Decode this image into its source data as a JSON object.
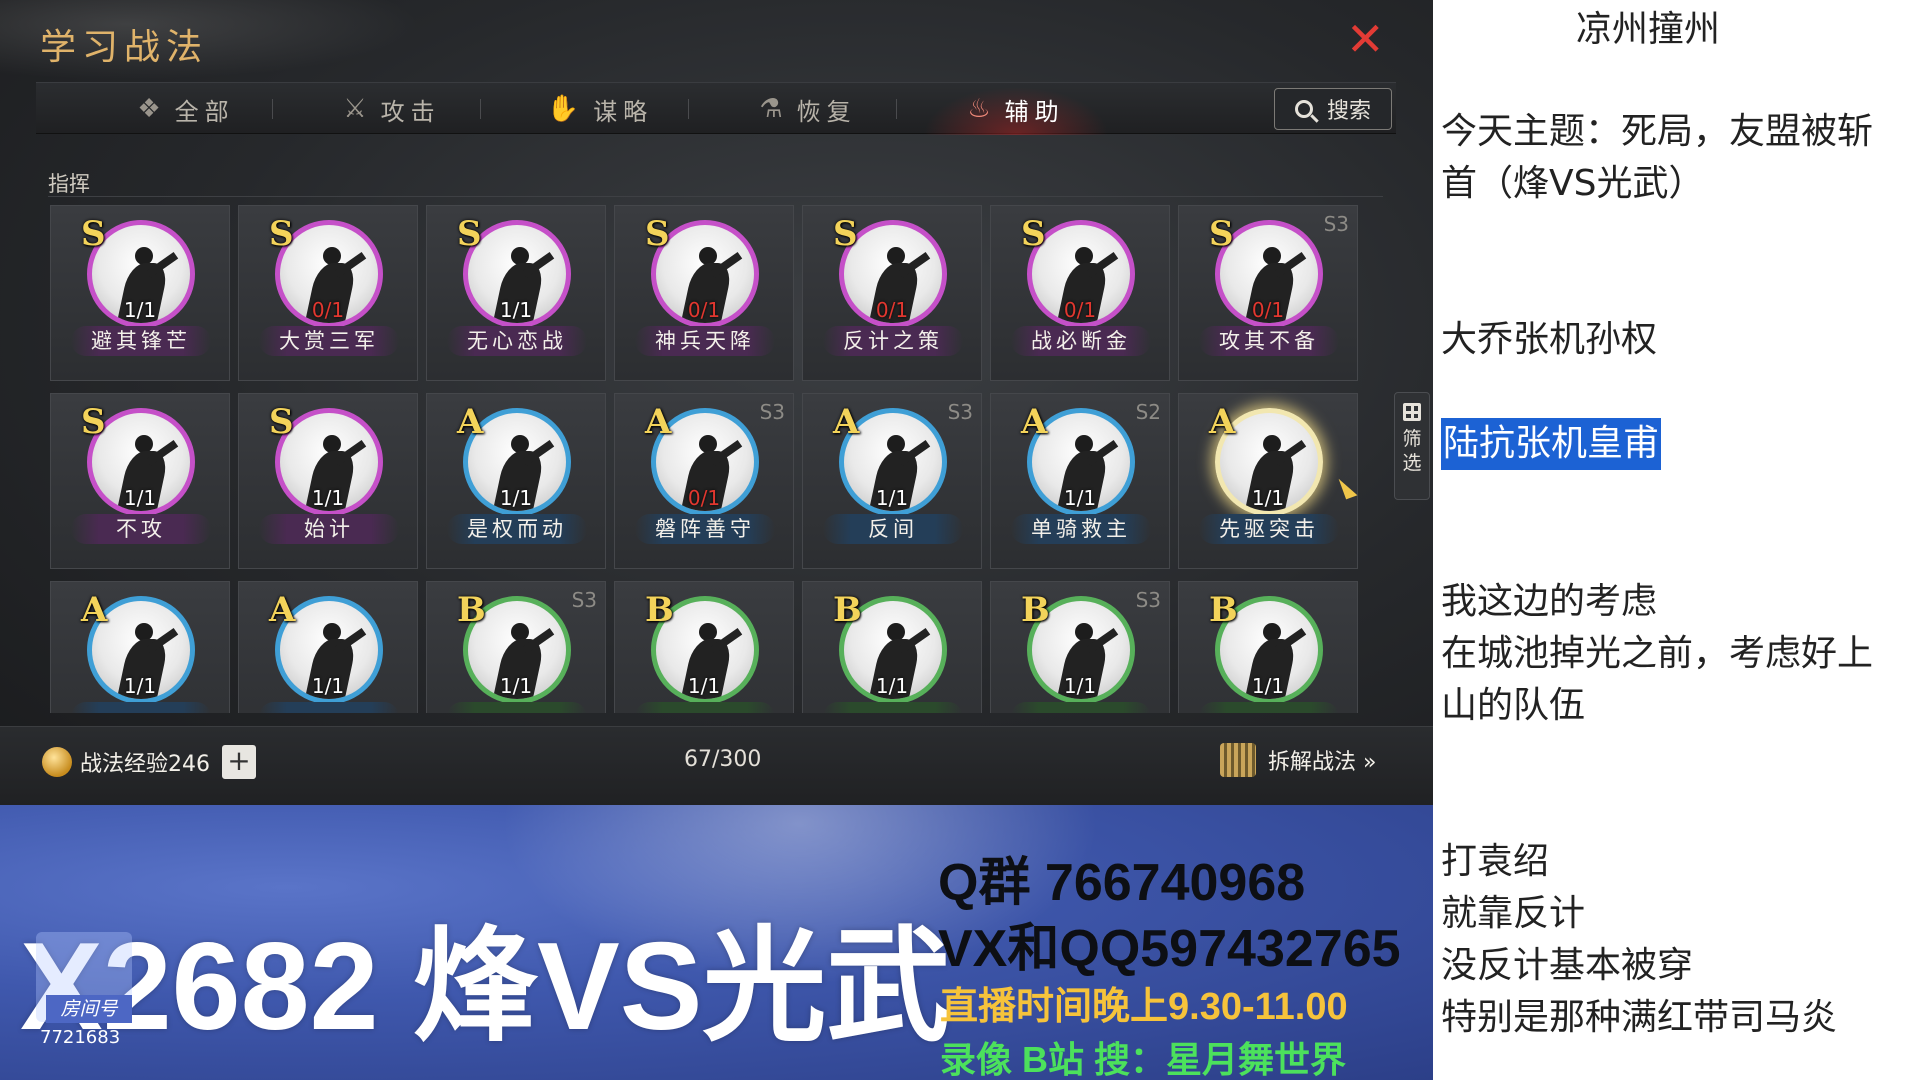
{
  "game": {
    "title": "学习战法",
    "close_glyph": "✕",
    "tabs": [
      {
        "label": "全部",
        "icon": "all-icon",
        "glyph": "❖"
      },
      {
        "label": "攻击",
        "icon": "swords-icon",
        "glyph": "⚔"
      },
      {
        "label": "谋略",
        "icon": "scroll-icon",
        "glyph": "✋"
      },
      {
        "label": "恢复",
        "icon": "potion-icon",
        "glyph": "⚗"
      },
      {
        "label": "辅助",
        "icon": "support-icon",
        "glyph": "♨"
      }
    ],
    "active_tab": "辅助",
    "search_label": "搜索",
    "section_title": "指挥",
    "filter_label": "筛选",
    "cards": [
      {
        "grade": "S",
        "level": "1/1",
        "name": "避其锋芒",
        "season": ""
      },
      {
        "grade": "S",
        "level": "0/1",
        "name": "大赏三军",
        "season": ""
      },
      {
        "grade": "S",
        "level": "1/1",
        "name": "无心恋战",
        "season": ""
      },
      {
        "grade": "S",
        "level": "0/1",
        "name": "神兵天降",
        "season": ""
      },
      {
        "grade": "S",
        "level": "0/1",
        "name": "反计之策",
        "season": ""
      },
      {
        "grade": "S",
        "level": "0/1",
        "name": "战必断金",
        "season": ""
      },
      {
        "grade": "S",
        "level": "0/1",
        "name": "攻其不备",
        "season": "S3"
      },
      {
        "grade": "S",
        "level": "1/1",
        "name": "不攻",
        "season": ""
      },
      {
        "grade": "S",
        "level": "1/1",
        "name": "始计",
        "season": ""
      },
      {
        "grade": "A",
        "level": "1/1",
        "name": "是权而动",
        "season": ""
      },
      {
        "grade": "A",
        "level": "0/1",
        "name": "磐阵善守",
        "season": "S3"
      },
      {
        "grade": "A",
        "level": "1/1",
        "name": "反间",
        "season": "S3"
      },
      {
        "grade": "A",
        "level": "1/1",
        "name": "单骑救主",
        "season": "S2"
      },
      {
        "grade": "A",
        "level": "1/1",
        "name": "先驱突击",
        "season": ""
      },
      {
        "grade": "A",
        "level": "1/1",
        "name": "",
        "season": ""
      },
      {
        "grade": "A",
        "level": "1/1",
        "name": "",
        "season": ""
      },
      {
        "grade": "B",
        "level": "1/1",
        "name": "",
        "season": "S3"
      },
      {
        "grade": "B",
        "level": "1/1",
        "name": "",
        "season": ""
      },
      {
        "grade": "B",
        "level": "1/1",
        "name": "",
        "season": ""
      },
      {
        "grade": "B",
        "level": "1/1",
        "name": "",
        "season": "S3"
      },
      {
        "grade": "B",
        "level": "1/1",
        "name": "",
        "season": ""
      }
    ],
    "footer": {
      "exp_label": "战法经验246",
      "plus": "+",
      "count": "67/300",
      "decompose_label": "拆解战法 »"
    }
  },
  "banner": {
    "title": "X2682 烽VS光武",
    "room_label": "房间号",
    "room_id": "7721683",
    "qq_group": "Q群 766740968",
    "vx": "VX和QQ597432765",
    "live_time": "直播时间晚上9.30-11.00",
    "record": "录像 B站 搜：星月舞世界"
  },
  "notes": {
    "heading": "凉州撞州",
    "lines": [
      "今天主题：死局，友盟被斩",
      "首（烽VS光武）",
      "大乔张机孙权",
      "陆抗张机皇甫",
      "我这边的考虑",
      "在城池掉光之前，考虑好上",
      "山的队伍",
      "打袁绍",
      "就靠反计",
      "没反计基本被穿",
      "特别是那种满红带司马炎"
    ],
    "highlight_color": "#1c62d4"
  },
  "colors": {
    "grade_S_ring": "#c550c8",
    "grade_A_ring": "#3f9fd6",
    "grade_B_ring": "#57b05a",
    "title_gold": "#e0b36a",
    "close_red": "#e23b35"
  }
}
